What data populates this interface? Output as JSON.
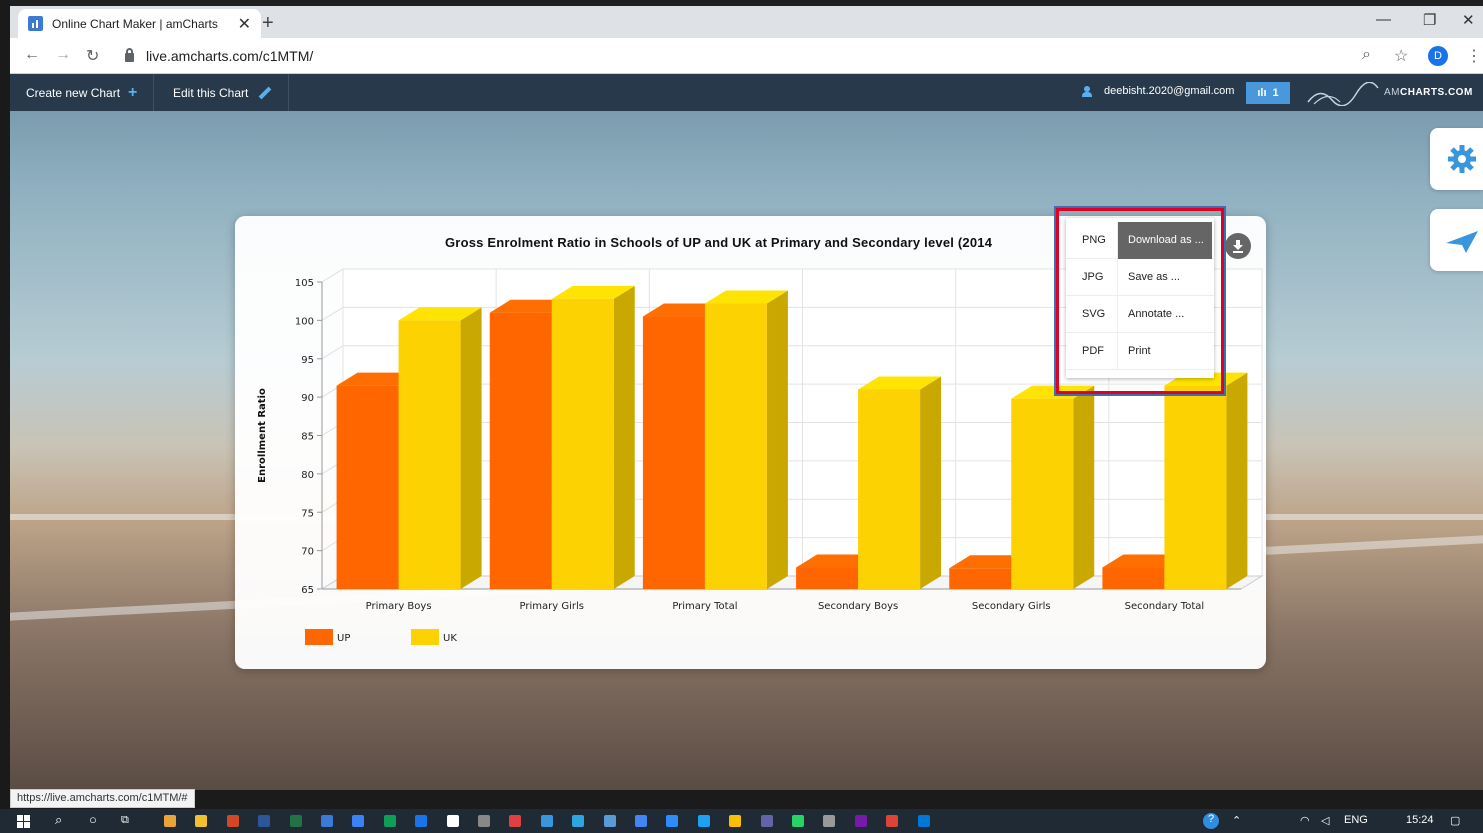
{
  "browser": {
    "tab_title": "Online Chart Maker | amCharts",
    "tab_close": "✕",
    "new_tab": "+",
    "minimize": "—",
    "restore": "❐",
    "close": "✕",
    "url": "live.amcharts.com/c1MTM/",
    "profile_initial": "D",
    "status_url": "https://live.amcharts.com/c1MTM/#"
  },
  "app": {
    "create_label": "Create new Chart",
    "edit_label": "Edit this Chart",
    "user_email": "deebisht.2020@gmail.com",
    "badge_count": "1",
    "brand_prefix": "AM",
    "brand_suffix": "CHARTS.COM"
  },
  "export_menu": {
    "items": [
      {
        "format": "PNG",
        "action": "Download as ..."
      },
      {
        "format": "JPG",
        "action": "Save as ..."
      },
      {
        "format": "SVG",
        "action": "Annotate ..."
      },
      {
        "format": "PDF",
        "action": "Print"
      }
    ]
  },
  "chart_data": {
    "type": "bar",
    "title": "Gross Enrolment Ratio in Schools of UP and UK at Primary and Secondary level (2014",
    "xlabel": "",
    "ylabel": "Enrollment Ratio",
    "ylim": [
      65,
      105
    ],
    "yticks": [
      65,
      70,
      75,
      80,
      85,
      90,
      95,
      100,
      105
    ],
    "categories": [
      "Primary Boys",
      "Primary Girls",
      "Primary Total",
      "Secondary Boys",
      "Secondary Girls",
      "Secondary Total"
    ],
    "series": [
      {
        "name": "UP",
        "color": "#ff6600",
        "values": [
          91.5,
          101,
          100.5,
          67.8,
          67.7,
          67.8
        ]
      },
      {
        "name": "UK",
        "color": "#fcd202",
        "values": [
          100,
          102.8,
          102.2,
          91,
          89.8,
          91.5
        ]
      }
    ],
    "grid": true,
    "legend": "bottom-left",
    "style": "3d-column"
  },
  "taskbar": {
    "lang": "ENG",
    "time": "15:24"
  }
}
